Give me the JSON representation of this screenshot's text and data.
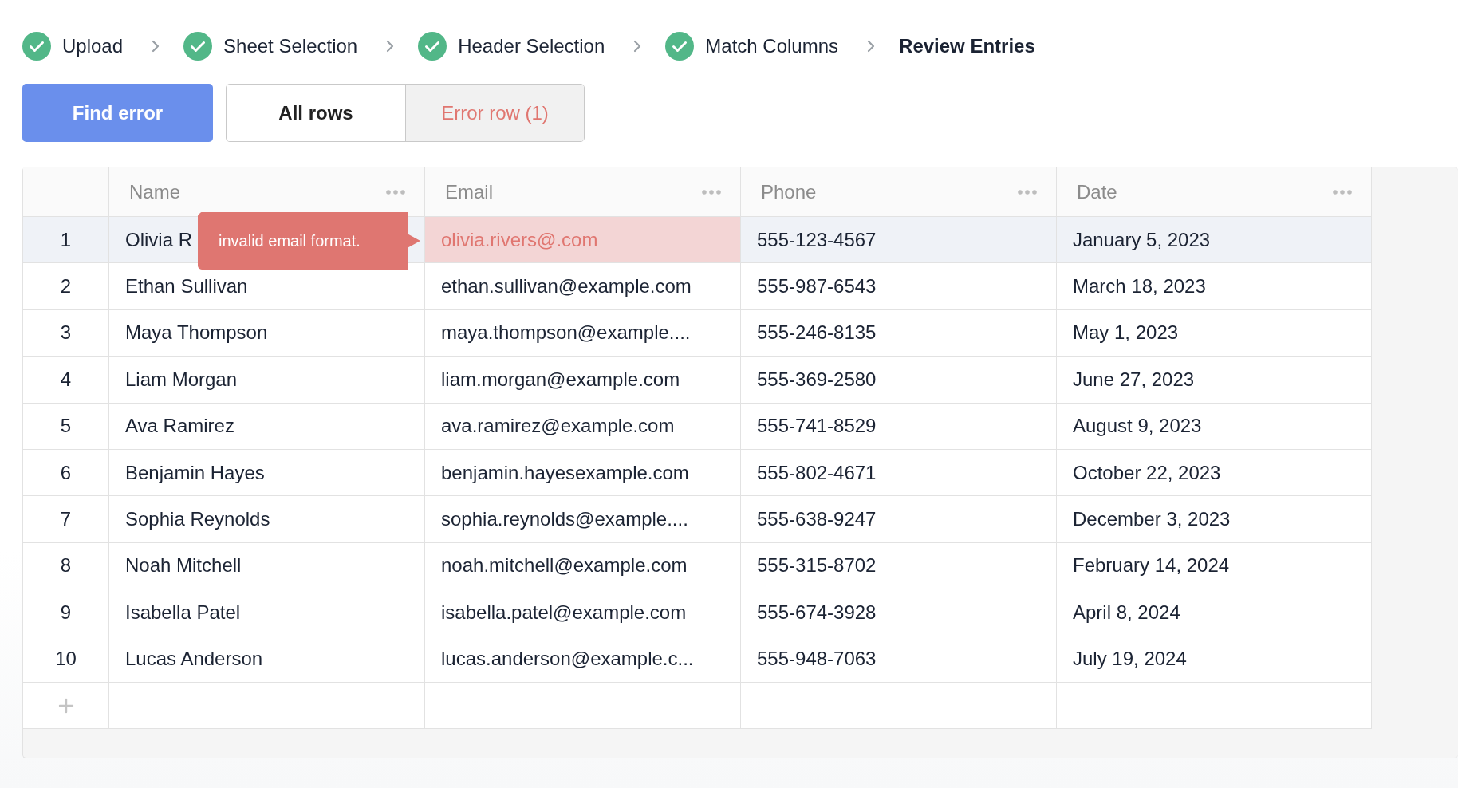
{
  "steps": [
    {
      "label": "Upload",
      "completed": true
    },
    {
      "label": "Sheet Selection",
      "completed": true
    },
    {
      "label": "Header Selection",
      "completed": true
    },
    {
      "label": "Match Columns",
      "completed": true
    },
    {
      "label": "Review Entries",
      "completed": false
    }
  ],
  "find_button": {
    "label": "Find error"
  },
  "filter_tabs": [
    {
      "label": "All rows",
      "selected": true,
      "kind": "all"
    },
    {
      "label": "Error row (1)",
      "selected": false,
      "kind": "error"
    }
  ],
  "table": {
    "columns": [
      "Name",
      "Email",
      "Phone",
      "Date"
    ],
    "rows": [
      {
        "index": "1",
        "selected": true,
        "name": "Olivia R",
        "email": "olivia.rivers@.com",
        "email_invalid": true,
        "error_tooltip": "invalid email format.",
        "phone": "555-123-4567",
        "date": "January 5, 2023"
      },
      {
        "index": "2",
        "selected": false,
        "name": "Ethan Sullivan",
        "email": "ethan.sullivan@example.com",
        "email_invalid": false,
        "phone": "555-987-6543",
        "date": "March 18, 2023"
      },
      {
        "index": "3",
        "selected": false,
        "name": "Maya Thompson",
        "email": "maya.thompson@example....",
        "email_invalid": false,
        "phone": "555-246-8135",
        "date": "May 1, 2023"
      },
      {
        "index": "4",
        "selected": false,
        "name": "Liam Morgan",
        "email": "liam.morgan@example.com",
        "email_invalid": false,
        "phone": "555-369-2580",
        "date": "June 27, 2023"
      },
      {
        "index": "5",
        "selected": false,
        "name": "Ava Ramirez",
        "email": "ava.ramirez@example.com",
        "email_invalid": false,
        "phone": "555-741-8529",
        "date": "August 9, 2023"
      },
      {
        "index": "6",
        "selected": false,
        "name": "Benjamin Hayes",
        "email": "benjamin.hayesexample.com",
        "email_invalid": false,
        "phone": "555-802-4671",
        "date": "October 22, 2023"
      },
      {
        "index": "7",
        "selected": false,
        "name": "Sophia Reynolds",
        "email": "sophia.reynolds@example....",
        "email_invalid": false,
        "phone": "555-638-9247",
        "date": "December 3, 2023"
      },
      {
        "index": "8",
        "selected": false,
        "name": "Noah Mitchell",
        "email": "noah.mitchell@example.com",
        "email_invalid": false,
        "phone": "555-315-8702",
        "date": "February 14, 2024"
      },
      {
        "index": "9",
        "selected": false,
        "name": "Isabella Patel",
        "email": "isabella.patel@example.com",
        "email_invalid": false,
        "phone": "555-674-3928",
        "date": "April 8, 2024"
      },
      {
        "index": "10",
        "selected": false,
        "name": "Lucas Anderson",
        "email": "lucas.anderson@example.c...",
        "email_invalid": false,
        "phone": "555-948-7063",
        "date": "July 19, 2024"
      }
    ]
  }
}
